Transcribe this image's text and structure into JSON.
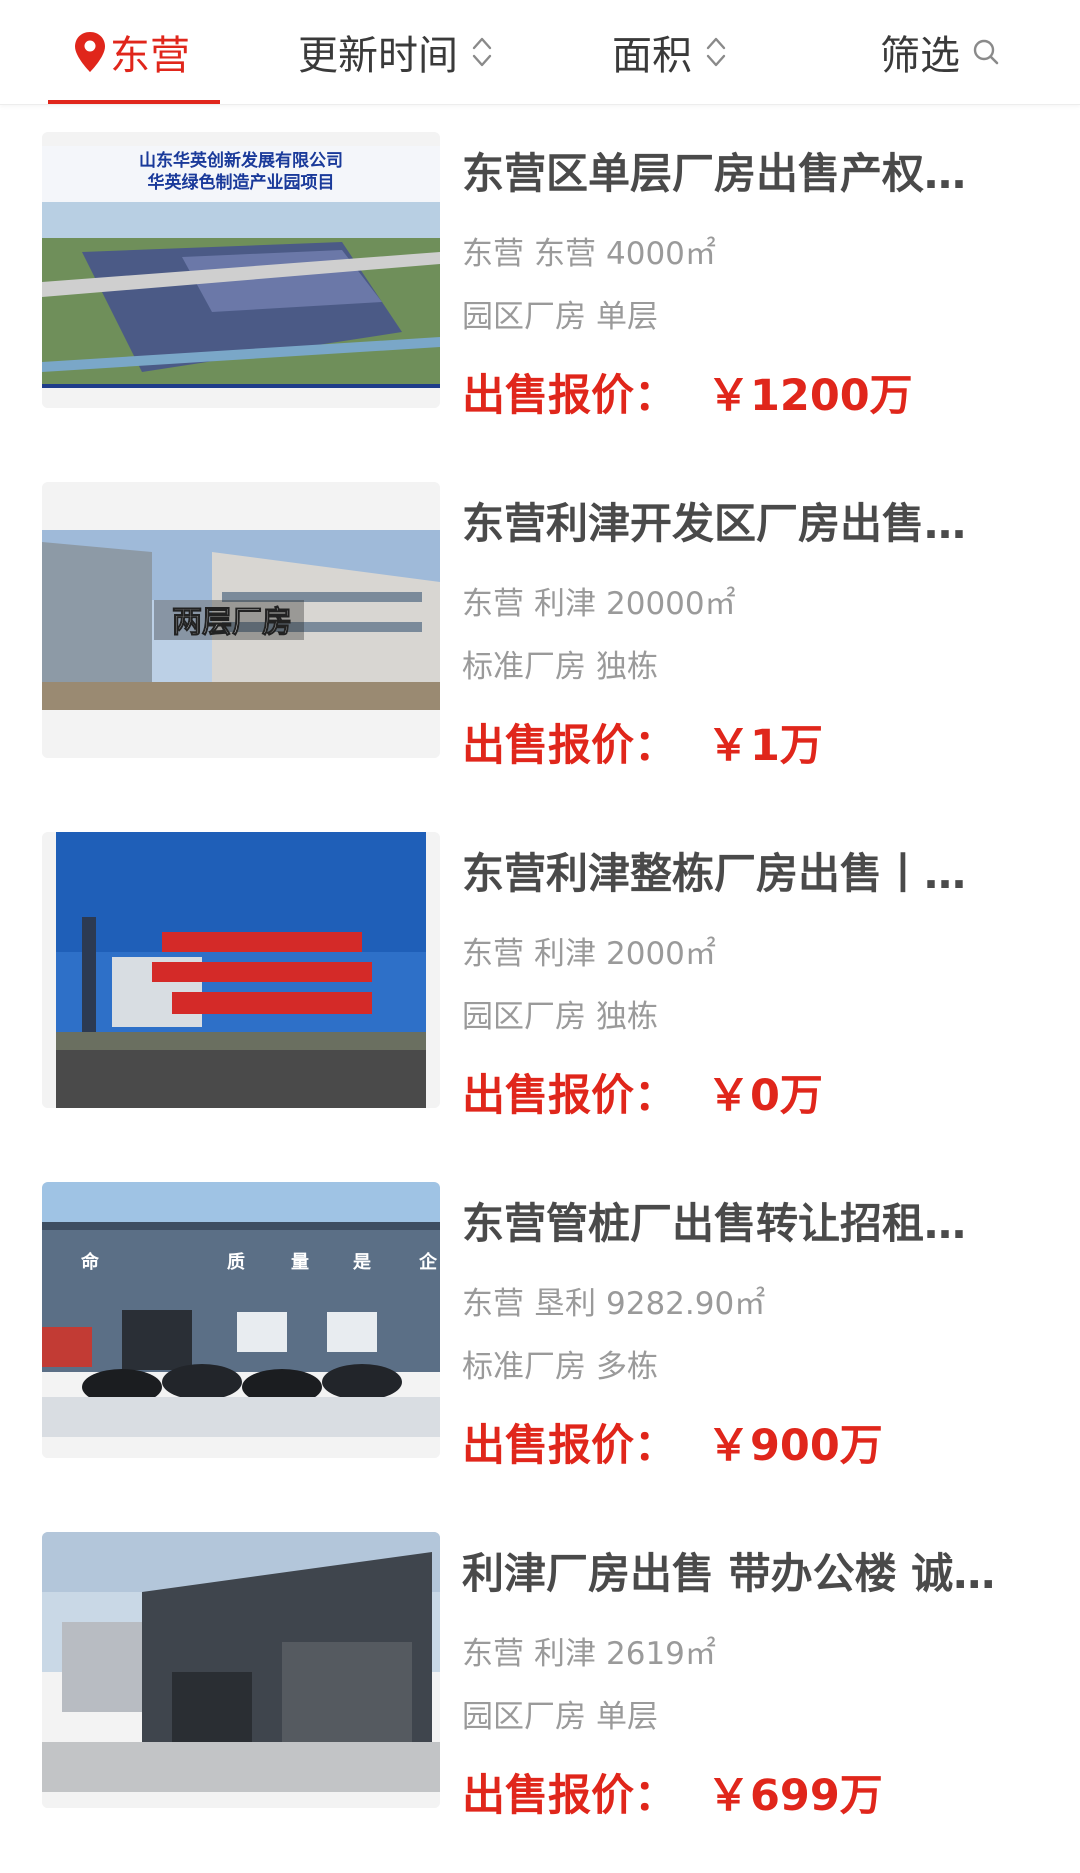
{
  "filter_bar": {
    "location": "东营",
    "update_time": "更新时间",
    "area": "面积",
    "filter": "筛选"
  },
  "colors": {
    "accent": "#e0261b",
    "title": "#4a4a4a",
    "meta": "#9a9a9a"
  },
  "listings": [
    {
      "title": "东营区单层厂房出售产权…",
      "city": "东营",
      "district": "东营",
      "area": "4000㎡",
      "category": "园区厂房",
      "building": "单层",
      "price_label": "出售报价：",
      "price": "￥1200万",
      "image_caption_line1": "山东华英创新发展有限公司",
      "image_caption_line2": "华英绿色制造产业园项目"
    },
    {
      "title": "东营利津开发区厂房出售…",
      "city": "东营",
      "district": "利津",
      "area": "20000㎡",
      "category": "标准厂房",
      "building": "独栋",
      "price_label": "出售报价：",
      "price": "￥1万",
      "image_caption": "两层厂房"
    },
    {
      "title": "东营利津整栋厂房出售丨…",
      "city": "东营",
      "district": "利津",
      "area": "2000㎡",
      "category": "园区厂房",
      "building": "独栋",
      "price_label": "出售报价：",
      "price": "￥0万"
    },
    {
      "title": "东营管桩厂出售转让招租…",
      "city": "东营",
      "district": "垦利",
      "area": "9282.90㎡",
      "category": "标准厂房",
      "building": "多栋",
      "price_label": "出售报价：",
      "price": "￥900万",
      "image_wall_text": [
        "命",
        "质",
        "量",
        "是",
        "企"
      ]
    },
    {
      "title": "利津厂房出售 带办公楼 诚…",
      "city": "东营",
      "district": "利津",
      "area": "2619㎡",
      "category": "园区厂房",
      "building": "单层",
      "price_label": "出售报价：",
      "price": "￥699万"
    }
  ]
}
